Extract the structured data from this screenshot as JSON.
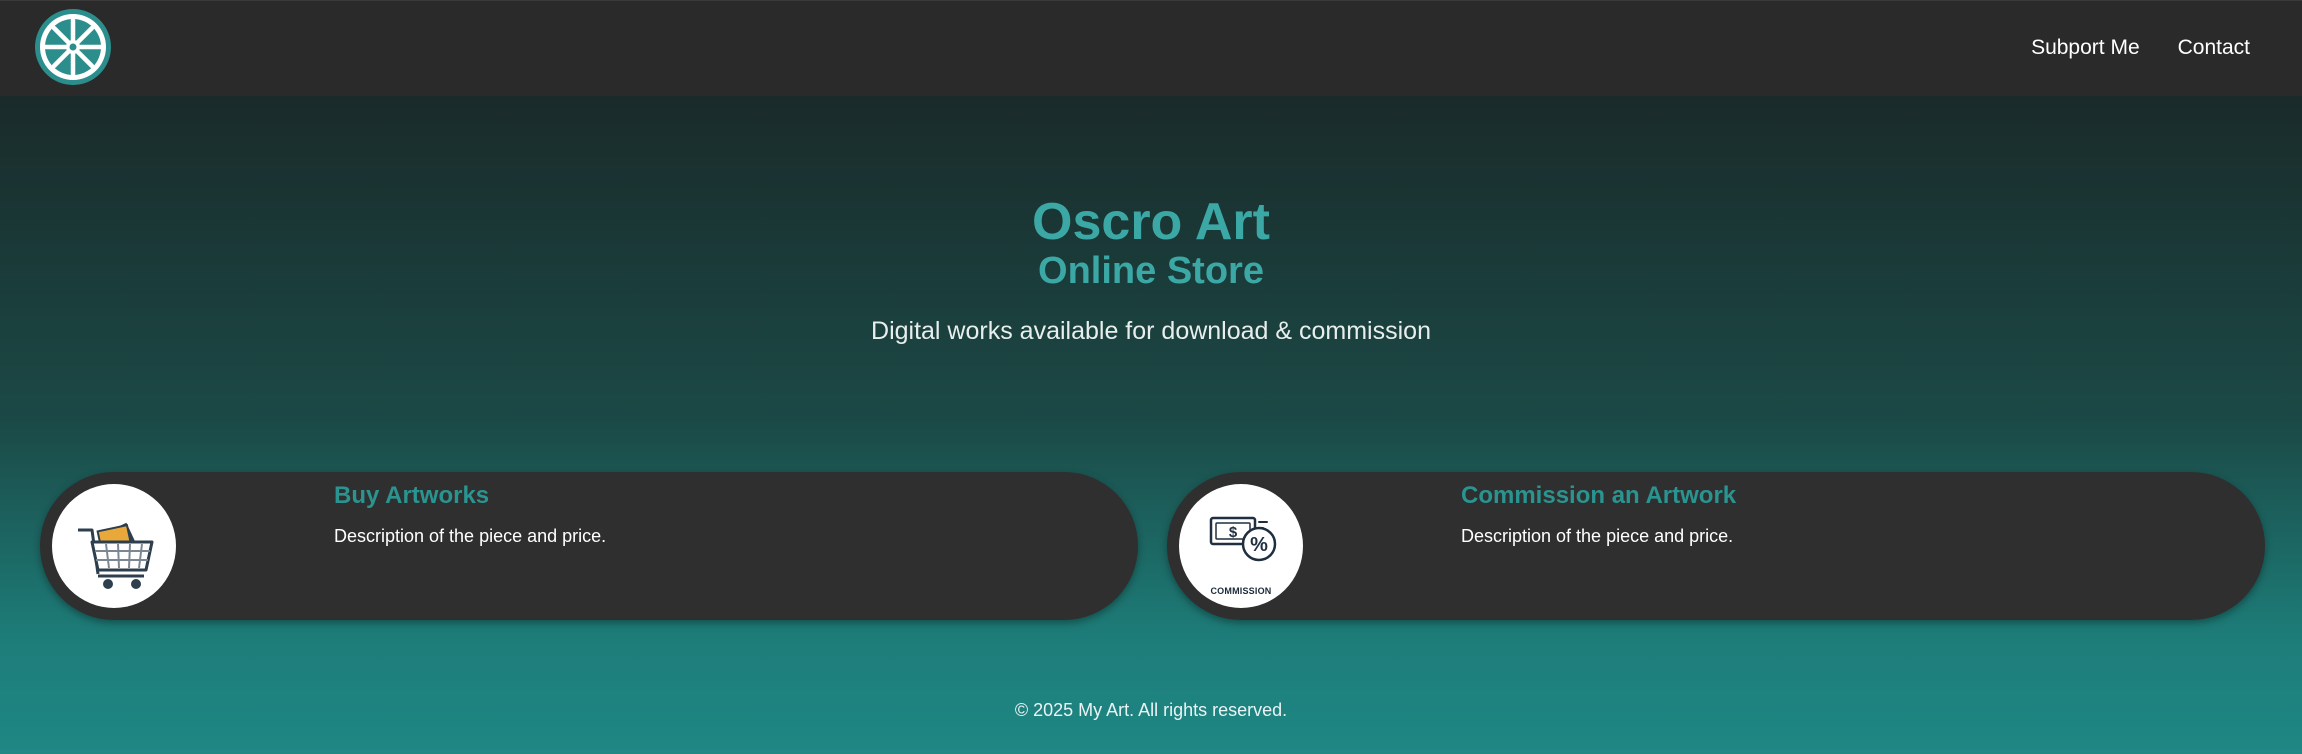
{
  "header": {
    "logo_icon": "wheel-logo-icon",
    "nav": [
      {
        "label": "Subport Me"
      },
      {
        "label": "Contact"
      }
    ]
  },
  "hero": {
    "title": "Oscro Art",
    "subtitle": "Online Store",
    "tagline": "Digital works available for download & commission"
  },
  "cards": [
    {
      "title": "Buy Artworks",
      "description": "Description of the piece and price.",
      "icon": "shopping-cart-icon"
    },
    {
      "title": "Commission an Artwork",
      "description": "Description of the piece and price.",
      "icon": "commission-money-icon",
      "icon_caption": "COMMISSION"
    }
  ],
  "footer": {
    "copyright": "© 2025 My Art. All rights reserved."
  },
  "colors": {
    "accent": "#3ba8a5",
    "card_title": "#2a9490",
    "card_bg": "#2f2f2f",
    "header_bg": "#2a2a2a"
  }
}
